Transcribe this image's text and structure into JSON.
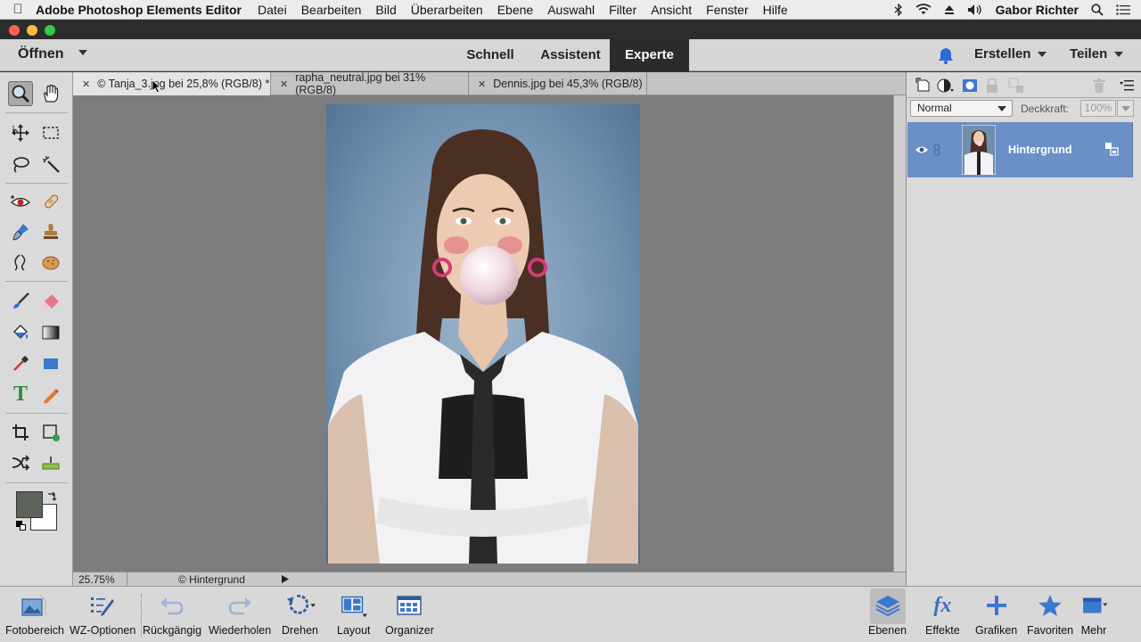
{
  "menubar": {
    "app_name": "Adobe Photoshop Elements Editor",
    "menus": [
      "Datei",
      "Bearbeiten",
      "Bild",
      "Überarbeiten",
      "Ebene",
      "Auswahl",
      "Filter",
      "Ansicht",
      "Fenster",
      "Hilfe"
    ],
    "user": "Gabor Richter"
  },
  "appbar": {
    "open_label": "Öffnen",
    "modes": [
      "Schnell",
      "Assistent",
      "Experte"
    ],
    "active_mode": "Experte",
    "create_label": "Erstellen",
    "share_label": "Teilen"
  },
  "tabs": [
    {
      "label": "© Tanja_3.jpg bei 25,8% (RGB/8) *",
      "active": true
    },
    {
      "label": "rapha_neutral.jpg bei 31% (RGB/8)",
      "active": false
    },
    {
      "label": "Dennis.jpg bei 45,3% (RGB/8)",
      "active": false
    }
  ],
  "status": {
    "zoom": "25.75%",
    "info": "© Hintergrund"
  },
  "layers": {
    "blend_mode": "Normal",
    "opacity_label": "Deckkraft:",
    "opacity_value": "100%",
    "layer_name": "Hintergrund"
  },
  "taskbar": {
    "left": [
      "Fotobereich",
      "WZ-Optionen",
      "Rückgängig",
      "Wiederholen",
      "Drehen",
      "Layout",
      "Organizer"
    ],
    "right": [
      "Ebenen",
      "Effekte",
      "Grafiken",
      "Favoriten",
      "Mehr"
    ]
  },
  "colors": {
    "accent_blue": "#6b8fc7",
    "expert_tab": "#2b2b2b",
    "foreground": "#5e6359",
    "background": "#ffffff"
  }
}
